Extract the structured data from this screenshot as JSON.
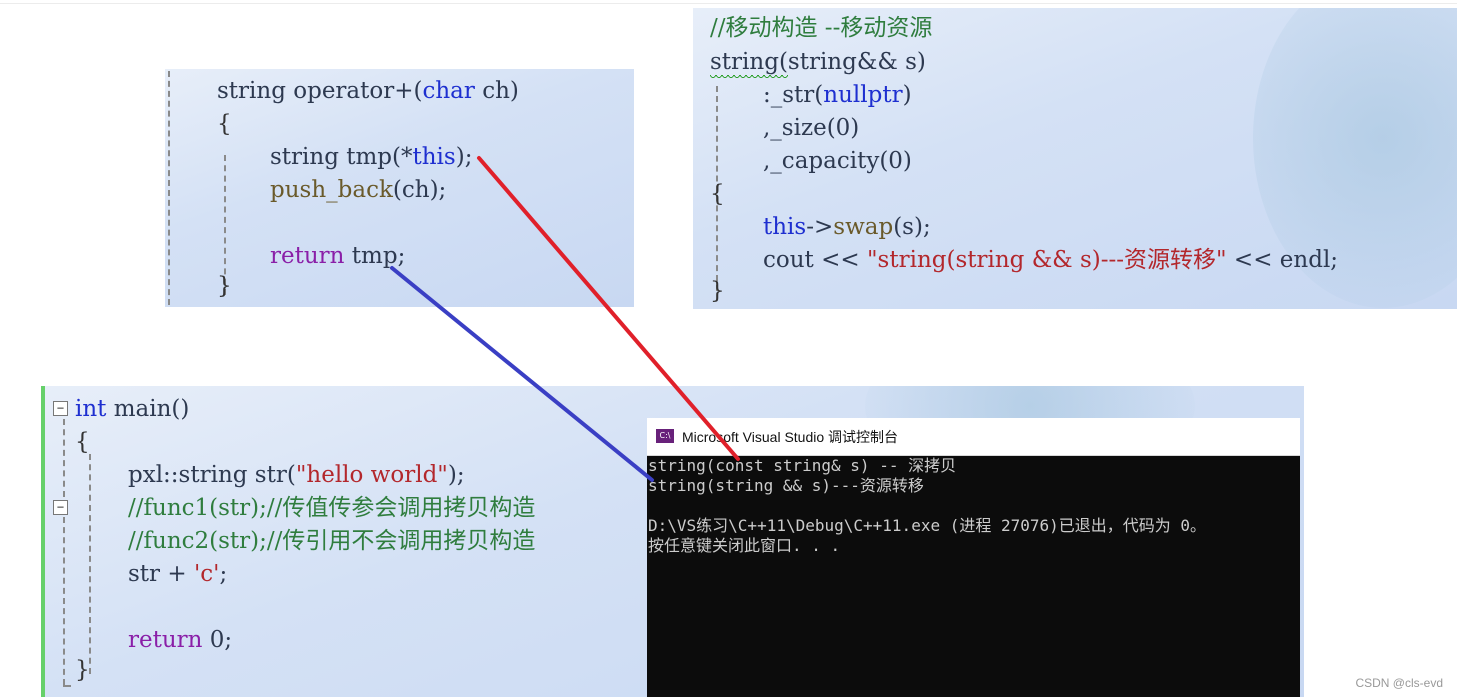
{
  "panel_operator": {
    "lines": {
      "sig_string": "string",
      "sig_operator": " operator+",
      "sig_open": "(",
      "sig_char": "char",
      "sig_ch": " ch)",
      "brace_open": "{",
      "tmp_decl_type": "string",
      "tmp_decl_name": " tmp(*",
      "tmp_decl_this": "this",
      "tmp_decl_end": ");",
      "push_back": "push_back",
      "push_back_args": "(ch);",
      "return_kw": "return",
      "return_val": " tmp;",
      "brace_close": "}"
    }
  },
  "panel_move": {
    "lines": {
      "comment": "//移动构造 --移动资源",
      "ctor_name": "string",
      "ctor_args": "(string&& s)",
      "init_str": ":_str(",
      "init_nullptr": "nullptr",
      "init_str_end": ")",
      "init_size": ",_size(0)",
      "init_capacity": ",_capacity(0)",
      "brace_open": "{",
      "swap_this": "this",
      "swap_rest": "->",
      "swap_fn": "swap",
      "swap_args": "(s);",
      "cout_kw": "cout ",
      "cout_op": "<<",
      "cout_str": " \"string(string && s)---资源转移\"",
      "cout_op2": " <<",
      "cout_endl": " endl;",
      "brace_close": "}"
    }
  },
  "panel_main": {
    "lines": {
      "int_kw": "int",
      "main_sig": " main()",
      "brace_open": "{",
      "decl_prefix": "pxl::string str(",
      "decl_str": "\"hello world\"",
      "decl_end": ");",
      "comment1": "//func1(str);//传值传参会调用拷贝构造",
      "comment2": "//func2(str);//传引用不会调用拷贝构造",
      "expr_prefix": "str + ",
      "expr_char": "'c'",
      "expr_end": ";",
      "return_kw": "return",
      "return_val": " 0;",
      "brace_close": "}"
    },
    "collapse_glyph": "−"
  },
  "console": {
    "title": "Microsoft Visual Studio 调试控制台",
    "icon_label": "C:\\",
    "output": [
      "string(const string& s) -- 深拷贝",
      "string(string && s)---资源转移",
      "",
      "D:\\VS练习\\C++11\\Debug\\C++11.exe (进程 27076)已退出，代码为 0。",
      "按任意键关闭此窗口. . ."
    ]
  },
  "watermark": "CSDN @cls-evd",
  "colors": {
    "arrow_red": "#e0202a",
    "arrow_blue": "#3a3fc4",
    "keyword": "#1e2fd0",
    "string_literal": "#b3272c",
    "comment": "#2f7d3e",
    "console_bg": "#0c0c0c"
  }
}
